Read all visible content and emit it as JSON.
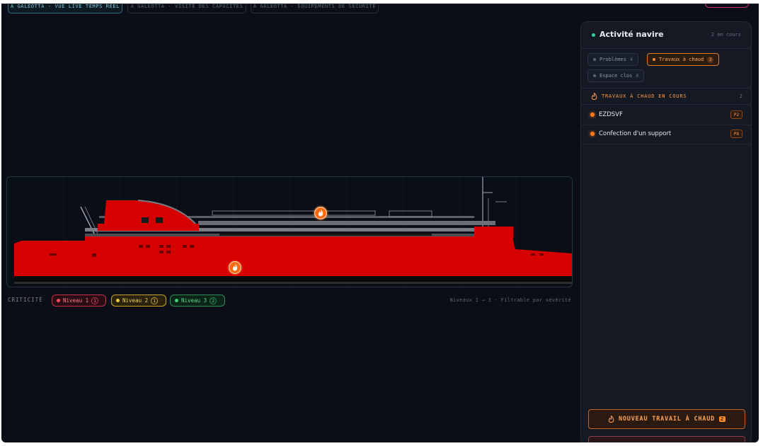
{
  "tabs": [
    {
      "label": "À GALEOTTA · VUE LIVE TEMPS RÉEL",
      "active": true
    },
    {
      "label": "À GALEOTTA · VISITE DES CAPACITÉS",
      "active": false
    },
    {
      "label": "À GALEOTTA · ÉQUIPEMENTS DE SÉCURITÉ",
      "active": false
    }
  ],
  "ship": {
    "hull_color": "#d60000",
    "markers": [
      {
        "type": "hot-work",
        "icon": "flame-icon"
      },
      {
        "type": "hot-work",
        "icon": "flame-icon"
      }
    ]
  },
  "criticity": {
    "label": "CRITICITÉ",
    "levels": [
      {
        "label": "Niveau 1",
        "count": "1",
        "color": "#ff4a63"
      },
      {
        "label": "Niveau 2",
        "count": "1",
        "color": "#f5c930"
      },
      {
        "label": "Niveau 3",
        "count": "2",
        "color": "#3bd17a"
      }
    ],
    "hint": "Niveaux 1 → 3 · Filtrable par sévérité"
  },
  "sidebar": {
    "title": "Activité navire",
    "count": "2 en cours",
    "filters": [
      {
        "label": "Problèmes",
        "count": "4",
        "active": false
      },
      {
        "label": "Travaux à chaud",
        "count": "2",
        "active": true
      },
      {
        "label": "Espace clos",
        "count": "0",
        "active": false
      }
    ],
    "section": {
      "title": "TRAVAUX À CHAUD EN COURS",
      "count": "2"
    },
    "items": [
      {
        "label": "EZDSVF",
        "tag": "P2"
      },
      {
        "label": "Confection d'un support",
        "tag": "P8"
      }
    ],
    "cta": {
      "label": "NOUVEAU TRAVAIL À CHAUD",
      "badge": "2"
    }
  }
}
